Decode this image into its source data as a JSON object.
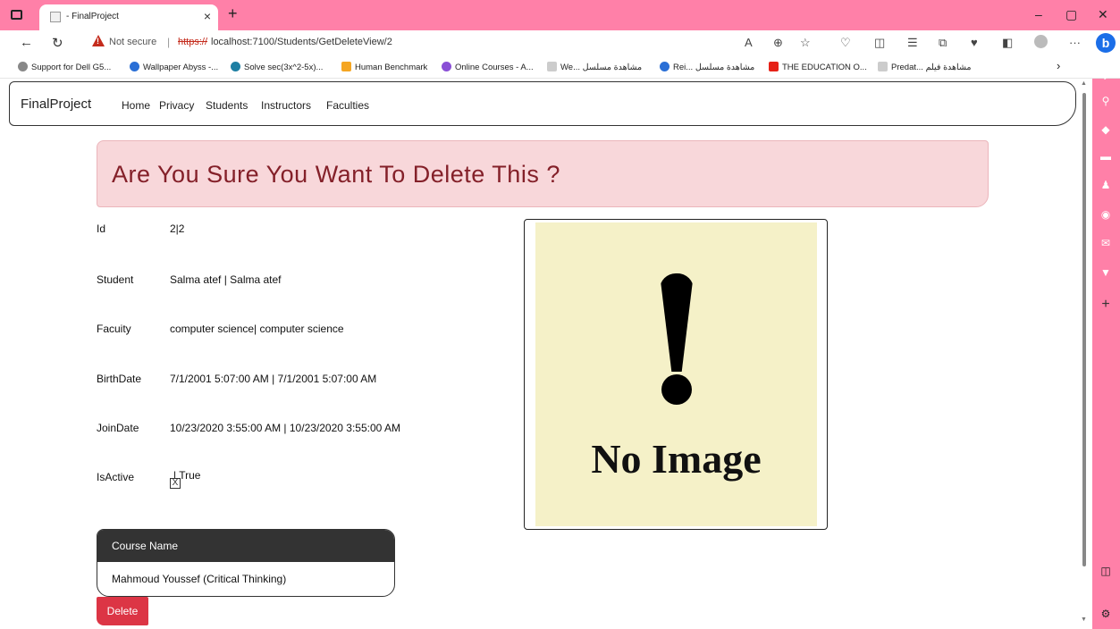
{
  "browser": {
    "tab_title": "- FinalProject",
    "tab_close": "×",
    "new_tab": "+",
    "minimize": "–",
    "restore": "▢",
    "close": "✕",
    "not_secure": "Not secure",
    "url_scheme": "https://",
    "url_rest": "localhost:7100/Students/GetDeleteView/2",
    "bookmarks": [
      "Support for Dell G5...",
      "Wallpaper Abyss -...",
      "Solve sec(3x^2-5x)...",
      "Human Benchmark",
      "Online Courses - A...",
      "We... مشاهدة مسلسل",
      "Rei... مشاهدة مسلسل",
      "THE EDUCATION O...",
      "Predat... مشاهدة فيلم"
    ],
    "bookmark_more": "›"
  },
  "site": {
    "brand": "FinalProject",
    "nav": [
      "Home",
      "Privacy",
      "Students",
      "Instructors",
      "Faculties"
    ]
  },
  "banner": {
    "text": "Are You Sure You Want To Delete This ?"
  },
  "details": {
    "id": {
      "label": "Id",
      "value": "2|2"
    },
    "student": {
      "label": "Student",
      "value": "Salma atef | Salma atef"
    },
    "faculty": {
      "label": "Facuity",
      "value": "computer science| computer science"
    },
    "birthdate": {
      "label": "BirthDate",
      "value": "7/1/2001 5:07:00 AM | 7/1/2001 5:07:00 AM"
    },
    "joindate": {
      "label": "JoinDate",
      "value": "10/23/2020 3:55:00 AM | 10/23/2020 3:55:00 AM"
    },
    "isactive": {
      "label": "IsActive",
      "value": "| True",
      "checkbox_mark": "X"
    }
  },
  "placeholder_image": {
    "text": "No Image"
  },
  "courses": {
    "header": "Course Name",
    "rows": [
      "Mahmoud Youssef (Critical Thinking)"
    ]
  },
  "actions": {
    "delete": "Delete"
  },
  "colors": {
    "browser_frame": "#ff80a8",
    "banner_bg": "#f8d7da",
    "banner_text": "#842029",
    "delete_bg": "#dc3545",
    "table_head": "#333333",
    "no_image_bg": "#f5f1c8"
  }
}
